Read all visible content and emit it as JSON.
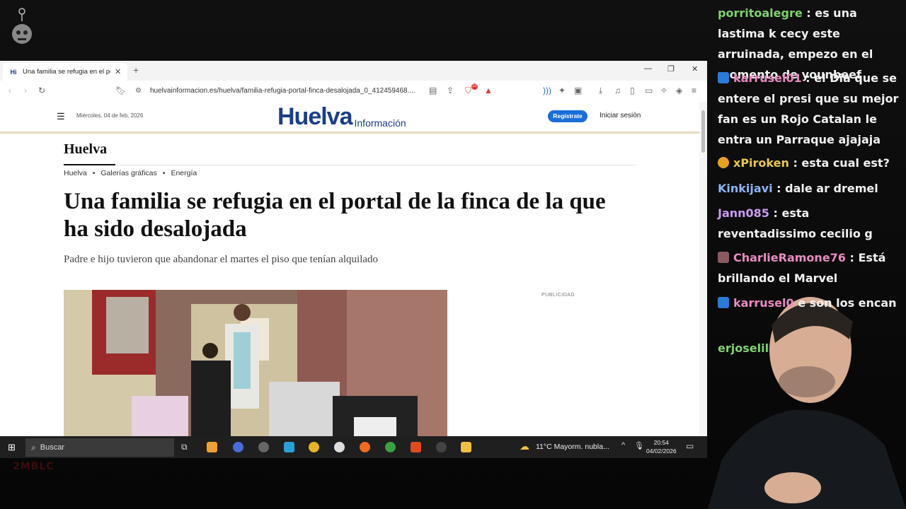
{
  "browser": {
    "tab_title": "Una familia se refugia en el port",
    "tab_favicon": "Hi",
    "url": "huelvainformacion.es/huelva/familia-refugia-portal-finca-desalojada_0_412459468....",
    "shield_badge": "10"
  },
  "site": {
    "date": "Miércoles, 04 de feb, 2026",
    "brand_main": "Huelva",
    "brand_sub": "Información",
    "register_label": "Regístrate",
    "login_label": "Iniciar sesión",
    "section": "Huelva",
    "breadcrumbs": [
      "Huelva",
      "Galerías gráficas",
      "Energía"
    ],
    "headline": "Una familia se refugia en el portal de la finca de la que ha sido desalojada",
    "subhead": "Padre e hijo tuvieron que abandonar el martes el piso que tenían alquilado",
    "ad_label": "PUBLICIDAD"
  },
  "taskbar": {
    "search_label": "Buscar",
    "weather": "11°C  Mayorm. nubla...",
    "time": "20:54",
    "date": "04/02/2026"
  },
  "chat": [
    {
      "user": "porritoalegre",
      "text": "es una lastima k cecy este arruinada, empezo en el momento de younbeef",
      "color": "#7ed36e"
    },
    {
      "user": "karrusel01",
      "text": "el Dia que se entere el presi que su mejor fan es un Rojo Catalan le entra un Parraque ajajaja",
      "color": "#e88ac0"
    },
    {
      "user": "xPiroken",
      "text": "esta cual est?",
      "color": "#e8c84a"
    },
    {
      "user": "Kinkijavi",
      "text": "dale ar dremel",
      "color": "#8cb4f0"
    },
    {
      "user": "Jann085",
      "text": "esta reventadissimo cecilio g",
      "color": "#c99bf0"
    },
    {
      "user": "CharlieRamone76",
      "text": "Está brillando el Marvel",
      "color": "#e88ac0"
    },
    {
      "user": "karrusel0",
      "text": "e son los encan",
      "color": "#e88ac0"
    },
    {
      "user": "erjoselil",
      "text": "",
      "color": "#7ed36e"
    }
  ],
  "stream": {
    "bottom_logo": "2MBLC"
  }
}
